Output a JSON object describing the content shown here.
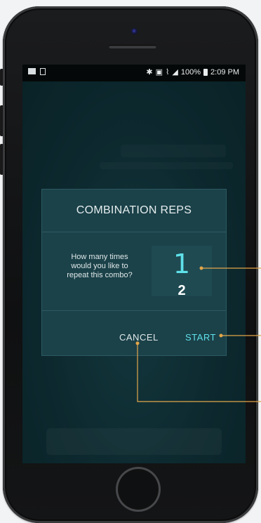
{
  "status_bar": {
    "left_icons": [
      "image-icon",
      "document-icon"
    ],
    "right_text": "100%",
    "time": "2:09 PM"
  },
  "dialog": {
    "title": "COMBINATION REPS",
    "prompt": "How many times\nwould you like to\nrepeat this combo?",
    "picker": {
      "current_value": "1",
      "next_value": "2"
    },
    "actions": {
      "cancel_label": "CANCEL",
      "start_label": "START"
    }
  },
  "colors": {
    "accent": "#5fe1ea",
    "callout": "#e2a64a",
    "dialog_bg": "#1b4149",
    "screen_bg": "#123840"
  }
}
